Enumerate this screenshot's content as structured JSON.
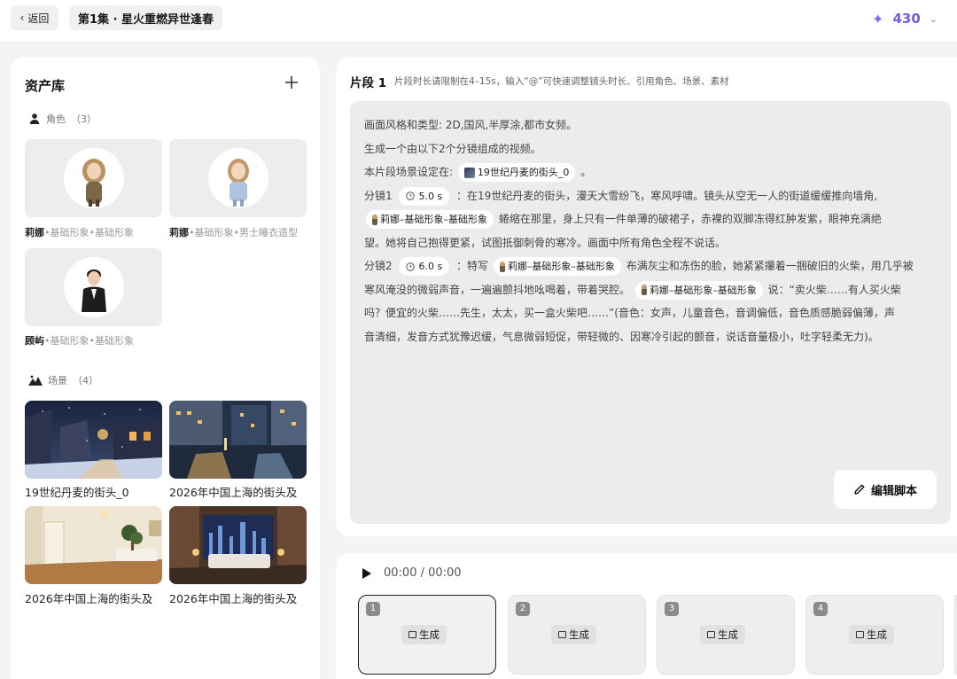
{
  "header": {
    "back_label": "返回",
    "episode_title": "第1集 · 星火重燃异世逢春",
    "credits": "430"
  },
  "assets": {
    "title": "资产库",
    "characters_label": "角色",
    "characters_count": "（3）",
    "characters": [
      {
        "name": "莉娜",
        "detail": "•基础形象•基础形象"
      },
      {
        "name": "莉娜",
        "detail": "•基础形象•男士睡衣造型"
      },
      {
        "name": "顾屿",
        "detail": "•基础形象•基础形象"
      }
    ],
    "scenes_label": "场景",
    "scenes_count": "（4）",
    "scenes": [
      {
        "name": "19世纪丹麦的街头_0"
      },
      {
        "name": "2026年中国上海的街头及"
      },
      {
        "name": "2026年中国上海的街头及"
      },
      {
        "name": "2026年中国上海的街头及"
      }
    ]
  },
  "segment": {
    "title": "片段 1",
    "hint": "片段时长请限制在4–15s，输入“@”可快速调整镜头时长、引用角色、场景、素材",
    "script": {
      "l1": "画面风格和类型: 2D,国风,半厚涂,都市女频。",
      "l2": "生成一个由以下2个分镜组成的视频。",
      "l3_pre": "本片段场景设定在:",
      "scene_chip": "19世纪丹麦的街头_0",
      "l3_post": "。",
      "shot1_label": "分镜1",
      "shot1_dur": "5.0 s",
      "shot1_text": "：在19世纪丹麦的街头，漫天大雪纷飞，寒风呼啸。镜头从空无一人的街道缓缓推向墙角,",
      "char_chip": "莉娜–基础形象–基础形象",
      "l5_post": "蜷缩在那里，身上只有一件单薄的破裙子，赤裸的双脚冻得红肿发紫，眼神充满绝",
      "l6": "望。她将自己抱得更紧，试图抵御刺骨的寒冷。画面中所有角色全程不说话。",
      "shot2_label": "分镜2",
      "shot2_dur": "6.0 s",
      "shot2_pre": "：特写",
      "shot2_post": "布满灰尘和冻伤的脸，她紧紧攥着一捆破旧的火柴，用几乎被",
      "l8_pre": "寒风淹没的微弱声音，一遍遍颤抖地吆喝着，带着哭腔。",
      "l8_post": "说：“卖火柴……有人买火柴",
      "l9": "吗？便宜的火柴……先生，太太，买一盒火柴吧……”(音色：女声，儿童音色，音调偏低，音色质感脆弱偏薄，声",
      "l10": "音清细，发音方式犹豫迟缓，气息微弱短促，带轻微的、因寒冷引起的颤音，说话音量极小，吐字轻柔无力)。"
    },
    "edit_label": "编辑脚本"
  },
  "player": {
    "time": "00:00 / 00:00",
    "shots": [
      {
        "index": "1",
        "gen_label": "生成"
      },
      {
        "index": "2",
        "gen_label": "生成"
      },
      {
        "index": "3",
        "gen_label": "生成"
      },
      {
        "index": "4",
        "gen_label": "生成"
      }
    ]
  },
  "colors": {
    "accent": "#6f5fe8",
    "panel": "#ffffff",
    "script_bg": "#ececed"
  },
  "icons": [
    "chevron-left-icon",
    "sparkle-icon",
    "chevron-down-icon",
    "plus-icon",
    "person-icon",
    "mountain-icon",
    "clock-icon",
    "pencil-icon",
    "play-icon",
    "film-icon"
  ]
}
